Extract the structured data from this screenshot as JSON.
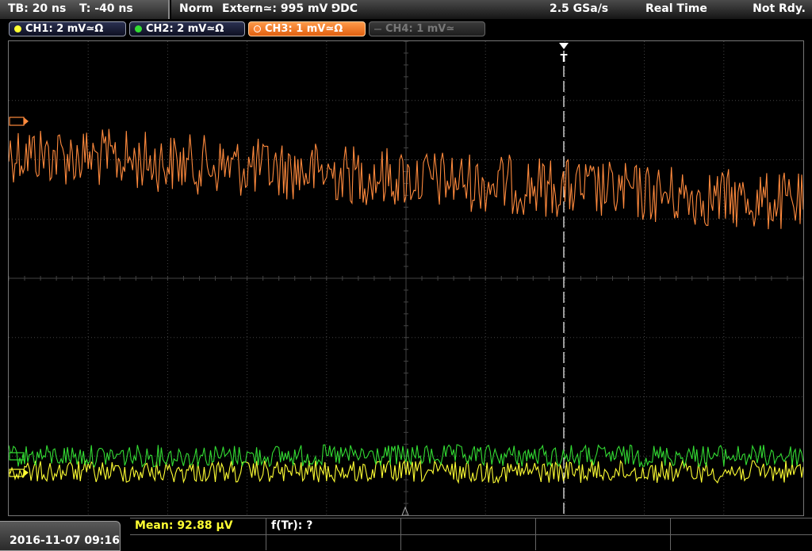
{
  "topbar": {
    "timebase": "TB: 20 ns",
    "trigger_time": "T: -40 ns",
    "trigger_mode": "Norm",
    "trigger_source": "Extern≃: 995 mV ⅁DC",
    "sample_rate": "2.5 GSa/s",
    "acq_mode": "Real Time",
    "trigger_status": "Not Rdy."
  },
  "channels": [
    {
      "label": "CH1: 2 mV≃Ω",
      "color": "#ffff33"
    },
    {
      "label": "CH2: 2 mV≃Ω",
      "color": "#33dd33"
    },
    {
      "label": "CH3: 1 mV≃Ω",
      "color": "#ff8a3d"
    },
    {
      "label": "CH4: 1 mV≃",
      "color": "#555555"
    }
  ],
  "measurements": {
    "mean": "Mean: 92.88 µV",
    "freq": "f(Tr): ?"
  },
  "datetime": "2016-11-07 09:16",
  "colors": {
    "ch1": "#ffff33",
    "ch2": "#33dd33",
    "ch3": "#ff8a3d",
    "grid": "#444444"
  }
}
